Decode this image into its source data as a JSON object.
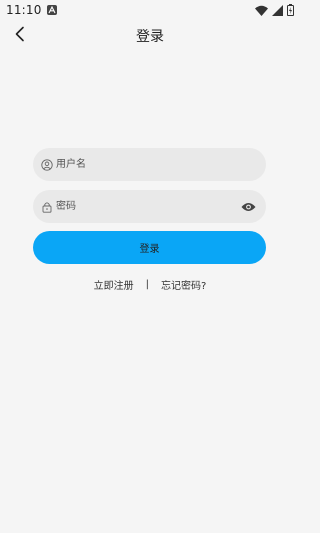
{
  "status_bar": {
    "time": "11:10",
    "icons": [
      "notification-a-icon",
      "wifi-icon",
      "signal-icon",
      "battery-charging-icon"
    ]
  },
  "header": {
    "title": "登录",
    "back_icon": "chevron-left-icon"
  },
  "form": {
    "username": {
      "placeholder": "用户名",
      "value": "",
      "icon": "user-icon"
    },
    "password": {
      "placeholder": "密码",
      "value": "",
      "icon": "lock-icon",
      "toggle_icon": "eye-icon"
    },
    "submit_label": "登录"
  },
  "links": {
    "register": "立即注册",
    "separator": "|",
    "forgot": "忘记密码?"
  },
  "colors": {
    "background": "#f5f5f5",
    "field_background": "#e9e9e9",
    "primary": "#0aa6f6"
  }
}
